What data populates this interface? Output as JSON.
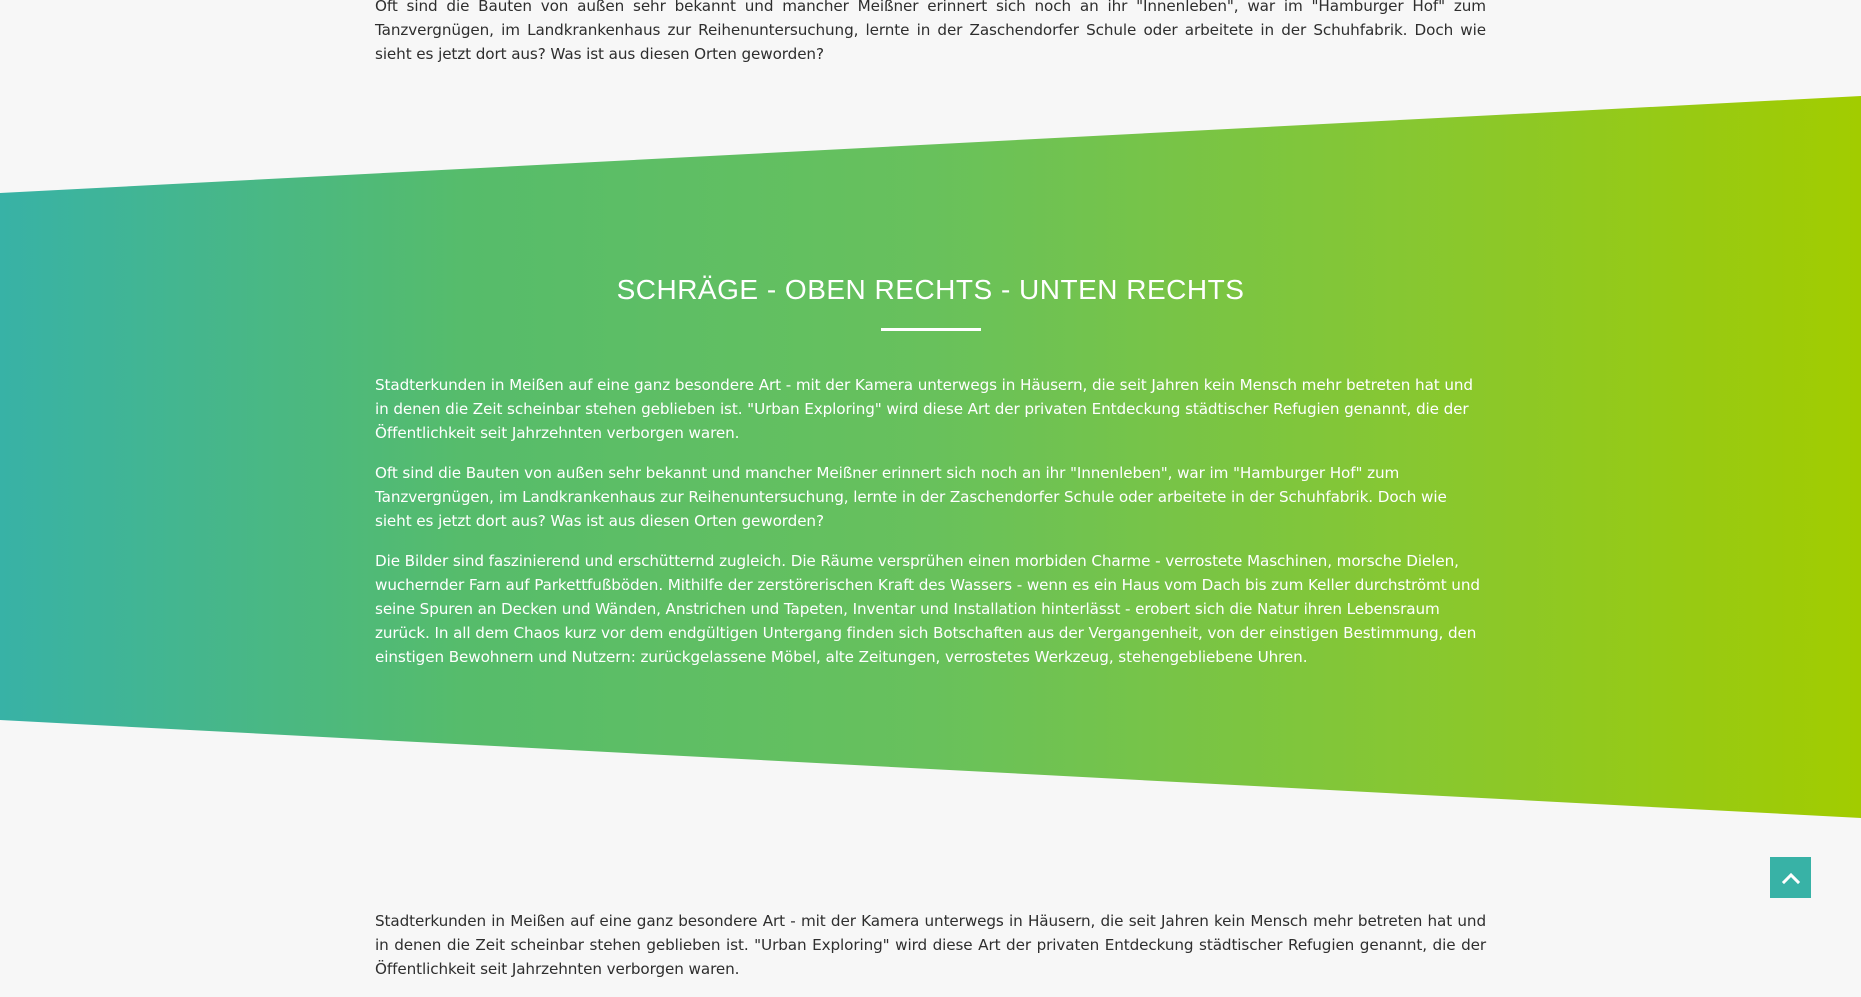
{
  "top": {
    "paragraph": "Oft sind die Bauten von außen sehr bekannt und mancher Meißner erinnert sich noch an ihr \"Innenleben\", war im \"Hamburger Hof\" zum Tanzvergnügen, im Landkrankenhaus zur Reihenuntersuchung, lernte in der Zaschendorfer Schule oder arbeitete in der Schuhfabrik. Doch wie sieht es jetzt dort aus? Was ist aus diesen Orten geworden?"
  },
  "band": {
    "title": "SCHRÄGE - OBEN RECHTS - UNTEN RECHTS",
    "paragraphs": [
      "Stadterkunden in Meißen auf eine ganz besondere Art - mit der Kamera unterwegs in Häusern, die seit Jahren kein Mensch mehr betreten hat und in denen die Zeit scheinbar stehen geblieben ist. \"Urban Exploring\" wird diese Art der privaten Entdeckung städtischer Refugien genannt, die der Öffentlichkeit seit Jahrzehnten verborgen waren.",
      "Oft sind die Bauten von außen sehr bekannt und mancher Meißner erinnert sich noch an ihr \"Innenleben\", war im \"Hamburger Hof\" zum Tanzvergnügen, im Landkrankenhaus zur Reihenuntersuchung, lernte in der Zaschendorfer Schule oder arbeitete in der Schuhfabrik. Doch wie sieht es jetzt dort aus? Was ist aus diesen Orten geworden?",
      "Die Bilder sind faszinierend und erschütternd zugleich. Die Räume versprühen einen morbiden Charme - verrostete Maschinen, morsche Dielen, wuchernder Farn auf Parkettfußböden. Mithilfe der zerstörerischen Kraft des Wassers - wenn es ein Haus vom Dach bis zum Keller durchströmt und seine Spuren an Decken und Wänden, Anstrichen und Tapeten, Inventar und Installation hinterlässt - erobert sich die Natur ihren Lebensraum zurück. In all dem Chaos kurz vor dem endgültigen Untergang finden sich Botschaften aus der Vergangenheit, von der einstigen Bestimmung, den einstigen Bewohnern und Nutzern: zurückgelassene Möbel, alte Zeitungen, verrostetes Werkzeug, stehengebliebene Uhren."
    ]
  },
  "bottom": {
    "paragraph": "Stadterkunden in Meißen auf eine ganz besondere Art - mit der Kamera unterwegs in Häusern, die seit Jahren kein Mensch mehr betreten hat und in denen die Zeit scheinbar stehen geblieben ist. \"Urban Exploring\" wird diese Art der privaten Entdeckung städtischer Refugien genannt, die der Öffentlichkeit seit Jahrzehnten verborgen waren."
  },
  "controls": {
    "scroll_top_icon": "chevron-up-icon"
  },
  "colors": {
    "gradient_start": "#38b2a6",
    "gradient_end": "#a2cc00",
    "page_background": "#f7f7f7",
    "button_background": "#38b2a6"
  }
}
